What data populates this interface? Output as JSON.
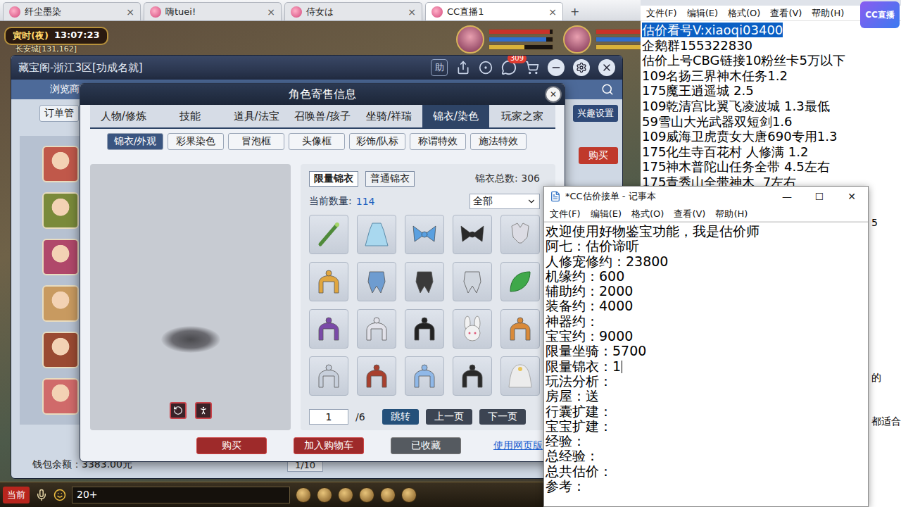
{
  "client_tabs": [
    {
      "label": "纤尘墨染",
      "selected": false
    },
    {
      "label": "嗨tuei!",
      "selected": false
    },
    {
      "label": "侍女は",
      "selected": false
    },
    {
      "label": "CC直播1",
      "selected": true
    }
  ],
  "client_tab_close": "×",
  "client_tab_add": "+",
  "hud": {
    "period": "寅时(夜)",
    "clock": "13:07:23",
    "location": "长安城[131,162]",
    "groups": [
      {
        "bars": [
          {
            "level": 0.95,
            "color": "#c8322a"
          },
          {
            "level": 0.9,
            "color": "#2f6fd0"
          },
          {
            "level": 0.55,
            "color": "#d9b23a"
          }
        ]
      },
      {
        "bars": [
          {
            "level": 1,
            "color": "#c8322a"
          },
          {
            "level": 0.85,
            "color": "#2f6fd0"
          },
          {
            "level": 0.7,
            "color": "#d9b23a"
          }
        ]
      }
    ]
  },
  "cbg": {
    "title": "藏宝阁-浙江3区[功成名就]",
    "help": "助",
    "cart_badge": "309",
    "nav": [
      "浏览商"
    ],
    "order": "订单管",
    "interest": "兴趣设置",
    "buy": "购买",
    "wallet": "钱包余额：3383.00元",
    "page": "1/10",
    "avatars": [
      {
        "color": "#c0584a"
      },
      {
        "color": "#7a8a3a"
      },
      {
        "color": "#b0486a"
      },
      {
        "color": "#c89a60"
      },
      {
        "color": "#9a4a32"
      },
      {
        "color": "#d06a6a"
      }
    ]
  },
  "modal": {
    "title": "角色寄售信息",
    "close": "✕",
    "tabs": [
      {
        "label": "人物/修炼",
        "selected": false
      },
      {
        "label": "技能",
        "selected": false
      },
      {
        "label": "道具/法宝",
        "selected": false
      },
      {
        "label": "召唤兽/孩子",
        "selected": false
      },
      {
        "label": "坐骑/祥瑞",
        "selected": false
      },
      {
        "label": "锦衣/染色",
        "selected": true
      },
      {
        "label": "玩家之家",
        "selected": false
      }
    ],
    "subtabs": [
      {
        "label": "锦衣/外观",
        "selected": true
      },
      {
        "label": "彩果染色",
        "selected": false
      },
      {
        "label": "冒泡框",
        "selected": false
      },
      {
        "label": "头像框",
        "selected": false
      },
      {
        "label": "彩饰/队标",
        "selected": false
      },
      {
        "label": "称谓特效",
        "selected": false
      },
      {
        "label": "施法特效",
        "selected": false
      }
    ],
    "kind_tabs": [
      {
        "label": "限量锦衣",
        "selected": true
      },
      {
        "label": "普通锦衣",
        "selected": false
      }
    ],
    "total": "锦衣总数: 306",
    "count_label": "当前数量:",
    "count": "114",
    "filter": "全部",
    "items": [
      {
        "kind": "staff",
        "color": "#4f8a3a"
      },
      {
        "kind": "robe",
        "color": "#a9d8ef"
      },
      {
        "kind": "bow",
        "color": "#5aa0e0"
      },
      {
        "kind": "bow",
        "color": "#2a2a2a"
      },
      {
        "kind": "top",
        "color": "#dcdce4"
      },
      {
        "kind": "hair",
        "color": "#e0a640"
      },
      {
        "kind": "garment",
        "color": "#6e9cd0"
      },
      {
        "kind": "garment",
        "color": "#3a3a3a"
      },
      {
        "kind": "garment",
        "color": "#d0d6de"
      },
      {
        "kind": "leaf",
        "color": "#3fa84a"
      },
      {
        "kind": "hair",
        "color": "#7a4aa8"
      },
      {
        "kind": "hair",
        "color": "#e2e2ea"
      },
      {
        "kind": "hair",
        "color": "#222222"
      },
      {
        "kind": "hat",
        "color": "#f2f2f2"
      },
      {
        "kind": "hair",
        "color": "#d98a3a"
      },
      {
        "kind": "hair",
        "color": "#c8d0dc"
      },
      {
        "kind": "hair",
        "color": "#a8402e"
      },
      {
        "kind": "hair",
        "color": "#8fb8e8"
      },
      {
        "kind": "hair",
        "color": "#2a2a2a"
      },
      {
        "kind": "veil",
        "color": "#ececec"
      }
    ],
    "page": "1",
    "pages": "/6",
    "jump": "跳转",
    "prev": "上一页",
    "next": "下一页",
    "actions": [
      {
        "label": "购买",
        "kind": "primary"
      },
      {
        "label": "加入购物车",
        "kind": "primary"
      },
      {
        "label": "已收藏",
        "kind": "muted"
      }
    ],
    "web_link": "使用网页版"
  },
  "notepad_main": {
    "menu": [
      "文件(F)",
      "编辑(E)",
      "格式(O)",
      "查看(V)",
      "帮助(H)"
    ],
    "lines": [
      {
        "text": "估价看号V:xiaoqi03400",
        "selected": true
      },
      {
        "text": "企鹅群155322830",
        "selected": false
      },
      {
        "text": "估价上号CBG链接10粉丝卡5万以下",
        "selected": false
      },
      {
        "text": "109名扬三界神木任务1.2",
        "selected": false
      },
      {
        "text": "175魔王逍遥城 2.5",
        "selected": false
      },
      {
        "text": "109乾清宫比翼飞凌波城 1.3最低",
        "selected": false
      },
      {
        "text": "59雪山大光武器双短剑1.6",
        "selected": false
      },
      {
        "text": "109威海卫虎贲女大唐690专用1.3",
        "selected": false
      },
      {
        "text": "175化生寺百花村 人修满 1.2",
        "selected": false
      },
      {
        "text": "175神木普陀山任务全带 4.5左右",
        "selected": false
      },
      {
        "text": "175青秀山全带神木  7左右",
        "selected": false
      }
    ],
    "fragments": [
      "5",
      "的",
      "都适合"
    ]
  },
  "notepad_pricing": {
    "title": "*CC估价接单 - 记事本",
    "controls": [
      "—",
      "☐",
      "✕"
    ],
    "menu": [
      "文件(F)",
      "编辑(E)",
      "格式(O)",
      "查看(V)",
      "帮助(H)"
    ],
    "lines": [
      {
        "text": "欢迎使用好物鉴宝功能，我是估价师",
        "caret": false
      },
      {
        "text": "阿七：估价谛听",
        "caret": false
      },
      {
        "text": "人修宠修约：23800",
        "caret": false
      },
      {
        "text": "机缘约：600",
        "caret": false
      },
      {
        "text": "辅助约：2000",
        "caret": false
      },
      {
        "text": "装备约：4000",
        "caret": false
      },
      {
        "text": "神器约：",
        "caret": false
      },
      {
        "text": "宝宝约：9000",
        "caret": false
      },
      {
        "text": "限量坐骑：5700",
        "caret": false
      },
      {
        "text": "限量锦衣：1",
        "caret": true
      },
      {
        "text": "玩法分析：",
        "caret": false
      },
      {
        "text": "房屋：送",
        "caret": false
      },
      {
        "text": "行囊扩建：",
        "caret": false
      },
      {
        "text": "宝宝扩建：",
        "caret": false
      },
      {
        "text": "经验：",
        "caret": false
      },
      {
        "text": "总经验：",
        "caret": false
      },
      {
        "text": "总共估价：",
        "caret": false
      },
      {
        "text": "参考：",
        "caret": false
      }
    ]
  },
  "chat": {
    "channel": "当前",
    "input": "20+"
  },
  "stream_logo": "CC直播"
}
